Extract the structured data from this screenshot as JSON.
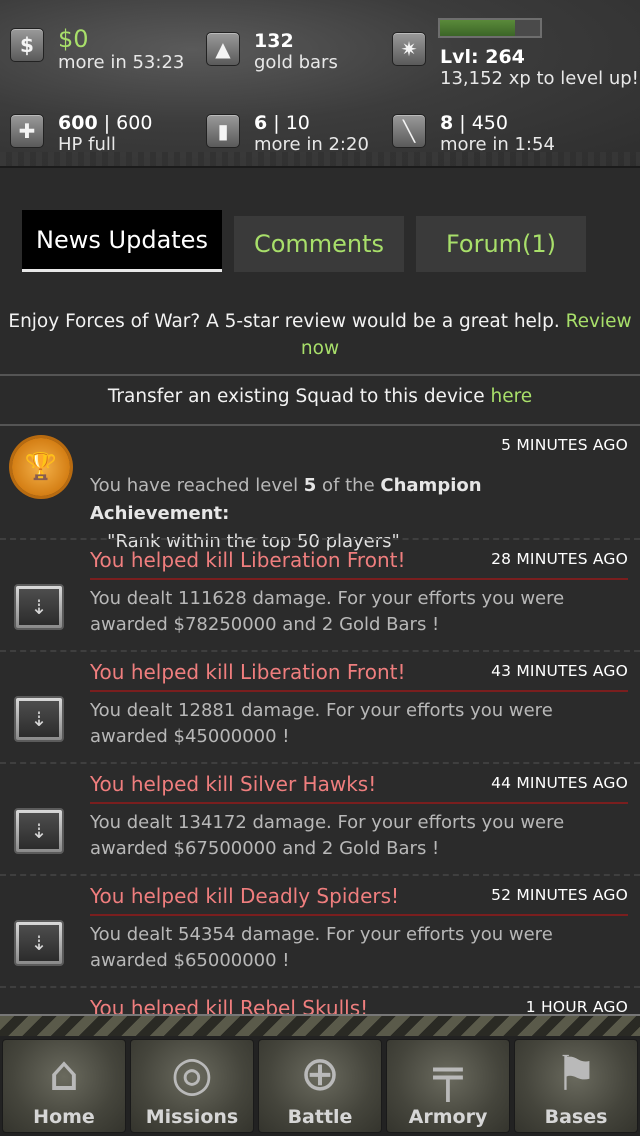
{
  "stats": {
    "cash": {
      "value": "$0",
      "sub": "more in 53:23",
      "icon": "dollar-icon"
    },
    "gold": {
      "value": "132",
      "sub": "gold bars",
      "icon": "gold-icon"
    },
    "level": {
      "value": "Lvl: 264",
      "sub": "13,152 xp to level up!",
      "icon": "rank-star-icon",
      "xp_progress": 0.75
    },
    "hp": {
      "value": "600",
      "max": "| 600",
      "sub": "HP full",
      "icon": "health-cross-icon"
    },
    "energy": {
      "value": "6",
      "max": "| 10",
      "sub": "more in 2:20",
      "icon": "ammo-icon"
    },
    "stamina": {
      "value": "8",
      "max": "| 450",
      "sub": "more in 1:54",
      "icon": "knife-icon"
    }
  },
  "tabs": [
    {
      "label": "News Updates",
      "active": true
    },
    {
      "label": "Comments",
      "active": false
    },
    {
      "label": "Forum(1)",
      "active": false
    }
  ],
  "promo": {
    "text": "Enjoy Forces of War? A 5-star review would be a great help.",
    "link1": "Review",
    "link2": "now"
  },
  "transfer": {
    "lead": "Transfer",
    "text": " an existing Squad to this device ",
    "link": "here"
  },
  "achievement": {
    "time": "5 MINUTES AGO",
    "pre": "You have reached level ",
    "level": "5",
    "mid": " of the ",
    "name": "Champion Achievement:",
    "desc": "\"Rank within the top 50 players\""
  },
  "feed": [
    {
      "title": "You helped kill Liberation Front!",
      "time": "28 MINUTES AGO",
      "line1": "You dealt 111628 damage. For your efforts you were",
      "line2": "awarded $78250000  and 2 Gold Bars !"
    },
    {
      "title": "You helped kill Liberation Front!",
      "time": "43 MINUTES AGO",
      "line1": "You dealt 12881 damage. For your efforts you were",
      "line2": "awarded $45000000 !"
    },
    {
      "title": "You helped kill Silver Hawks!",
      "time": "44 MINUTES AGO",
      "line1": "You dealt 134172 damage. For your efforts you were",
      "line2": "awarded $67500000  and 2 Gold Bars !"
    },
    {
      "title": "You helped kill Deadly Spiders!",
      "time": "52 MINUTES AGO",
      "line1": "You dealt 54354 damage. For your efforts you were",
      "line2": "awarded $65000000 !"
    },
    {
      "title": "You helped kill Rebel Skulls!",
      "time": "1 HOUR AGO",
      "line1": "",
      "line2": ""
    }
  ],
  "nav": [
    {
      "label": "Home",
      "icon": "home-icon"
    },
    {
      "label": "Missions",
      "icon": "radar-icon"
    },
    {
      "label": "Battle",
      "icon": "crosshair-icon"
    },
    {
      "label": "Armory",
      "icon": "rifle-icon"
    },
    {
      "label": "Bases",
      "icon": "flag-icon"
    }
  ],
  "colors": {
    "accent_green": "#a8df6a",
    "title_red": "#ef7e7e",
    "divider_red": "#7a1e1e"
  }
}
